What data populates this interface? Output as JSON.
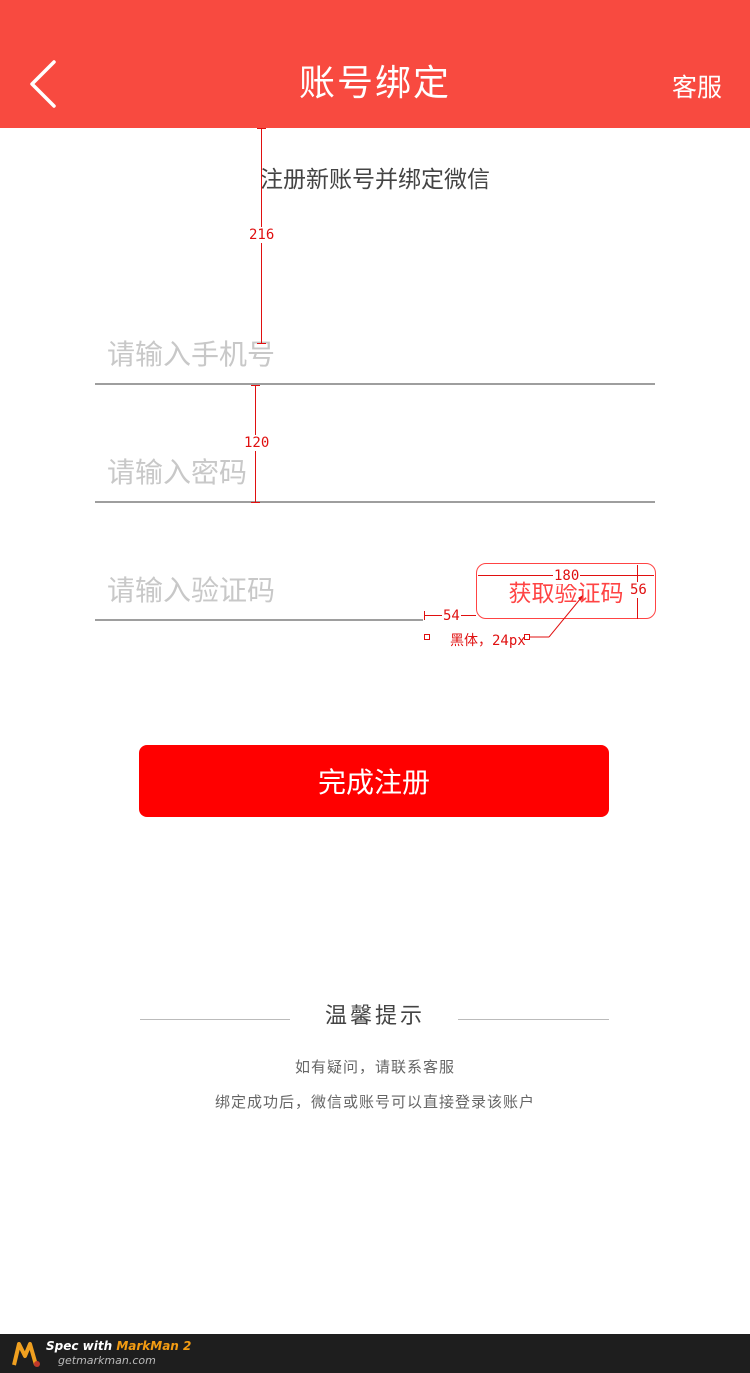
{
  "header": {
    "title": "账号绑定",
    "service_label": "客服",
    "back_icon": "chevron-left-icon",
    "background_color": "#f84a40"
  },
  "subtitle": "注册新账号并绑定微信",
  "form": {
    "phone_placeholder": "请输入手机号",
    "password_placeholder": "请输入密码",
    "code_placeholder": "请输入验证码",
    "get_code_label": "获取验证码",
    "submit_label": "完成注册",
    "accent_color": "#ff0000"
  },
  "annotations": {
    "gap_top": "216",
    "gap_fields": "120",
    "button_width": "180",
    "button_height": "56",
    "button_gap": "54",
    "font_note": "黑体，24px"
  },
  "tips": {
    "title": "温馨提示",
    "line1": "如有疑问，请联系客服",
    "line2": "绑定成功后，微信或账号可以直接登录该账户"
  },
  "footer": {
    "spec_prefix": "Spec with",
    "brand": "MarkMan 2",
    "url": "getmarkman.com",
    "logo_icon": "markman-logo-icon"
  }
}
